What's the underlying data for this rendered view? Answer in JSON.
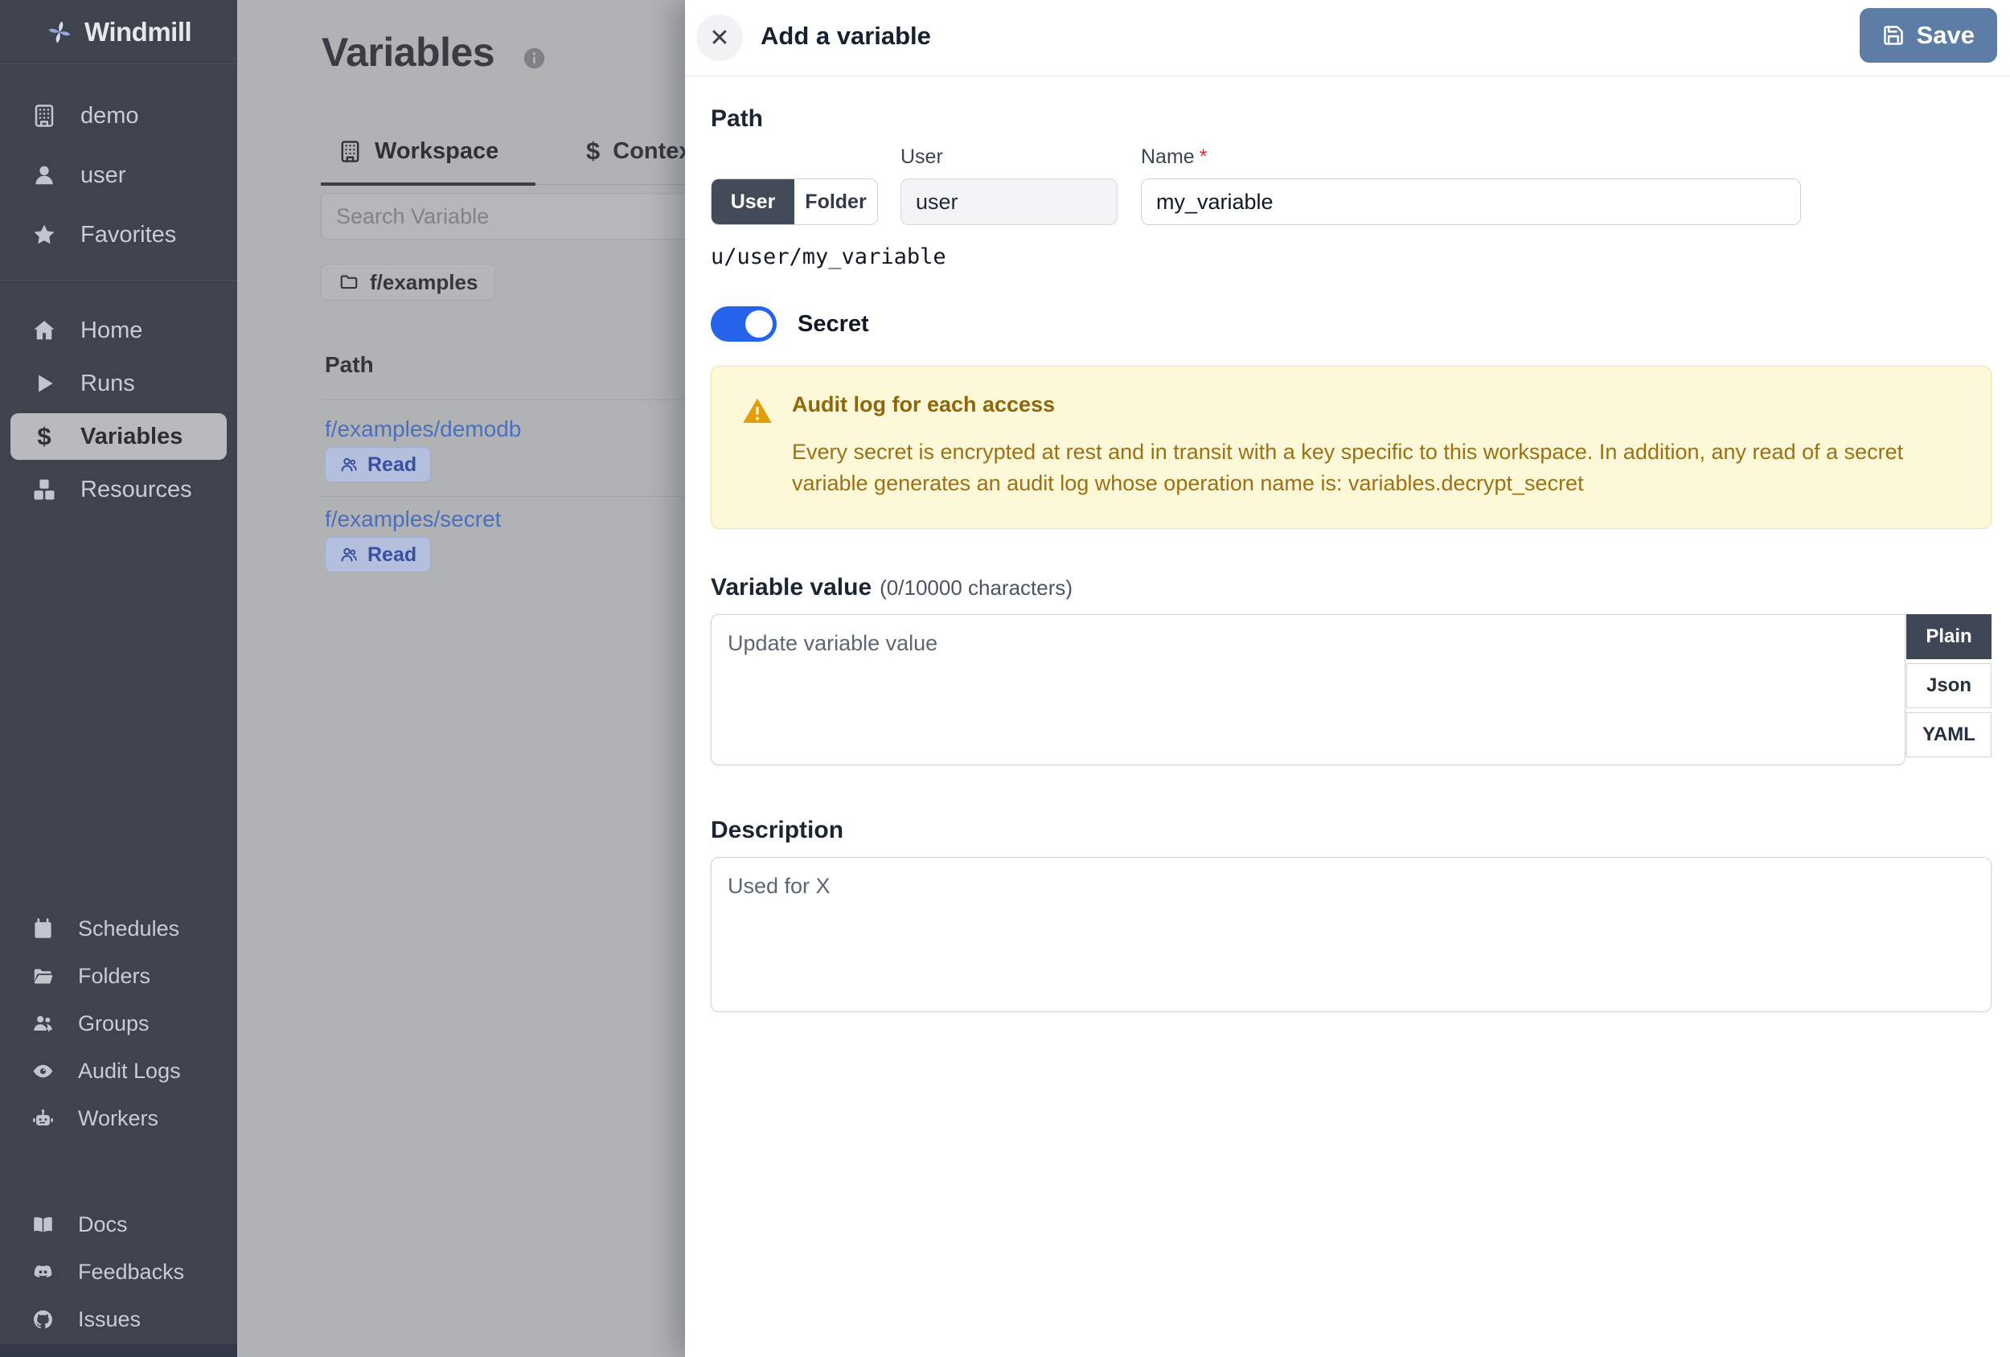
{
  "app": {
    "name": "Windmill"
  },
  "icons": {
    "dollar": "$",
    "close": "✕"
  },
  "sidebar": {
    "items_top": [
      {
        "label": "demo"
      },
      {
        "label": "user"
      },
      {
        "label": "Favorites"
      }
    ],
    "items_nav": [
      {
        "label": "Home",
        "active": false
      },
      {
        "label": "Runs",
        "active": false
      },
      {
        "label": "Variables",
        "active": true
      },
      {
        "label": "Resources",
        "active": false
      }
    ],
    "items_admin": [
      {
        "label": "Schedules"
      },
      {
        "label": "Folders"
      },
      {
        "label": "Groups"
      },
      {
        "label": "Audit Logs"
      },
      {
        "label": "Workers"
      }
    ],
    "items_footer": [
      {
        "label": "Docs"
      },
      {
        "label": "Feedbacks"
      },
      {
        "label": "Issues"
      }
    ]
  },
  "main": {
    "title": "Variables",
    "tabs": [
      {
        "label": "Workspace",
        "active": true
      },
      {
        "label": "Context",
        "active": false
      }
    ],
    "search_placeholder": "Search Variable",
    "folder_chip": "f/examples",
    "table": {
      "column_header": "Path",
      "rows": [
        {
          "path": "f/examples/demodb",
          "badge": "Read"
        },
        {
          "path": "f/examples/secret",
          "badge": "Read"
        }
      ]
    }
  },
  "drawer": {
    "title": "Add a variable",
    "save_label": "Save",
    "path": {
      "heading": "Path",
      "owner_options": [
        "User",
        "Folder"
      ],
      "owner_selected": "User",
      "user_label": "User",
      "user_value": "user",
      "name_label": "Name",
      "required_marker": "*",
      "name_value": "my_variable",
      "preview": "u/user/my_variable"
    },
    "secret_toggle": {
      "label": "Secret",
      "enabled": true
    },
    "warning": {
      "title": "Audit log for each access",
      "body": "Every secret is encrypted at rest and in transit with a key specific to this workspace. In addition, any read of a secret variable generates an audit log whose operation name is: variables.decrypt_secret"
    },
    "value": {
      "heading": "Variable value",
      "counter": "(0/10000 characters)",
      "placeholder": "Update variable value",
      "format_tabs": [
        {
          "label": "Plain",
          "active": true
        },
        {
          "label": "Json",
          "active": false
        },
        {
          "label": "YAML",
          "active": false
        }
      ]
    },
    "description": {
      "heading": "Description",
      "placeholder": "Used for X"
    }
  },
  "colors": {
    "sidebar_bg": "#3e434e",
    "accent_blue": "#2563eb",
    "save_button": "#5d7ca6",
    "warning_bg": "#fcf8d8",
    "warning_text": "#9c7013",
    "link_blue": "#4b6fc0"
  }
}
